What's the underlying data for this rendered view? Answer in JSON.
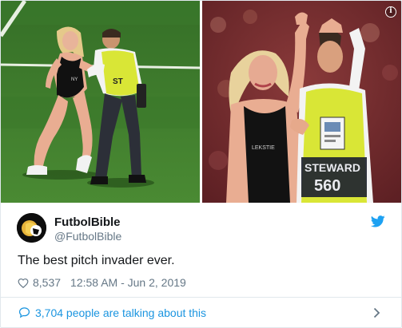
{
  "tweet": {
    "author": {
      "display_name": "FutbolBible",
      "handle": "@FutbolBible"
    },
    "text": "The best pitch invader ever.",
    "likes": "8,537",
    "timestamp": "12:58 AM - Jun 2, 2019",
    "talking": "3,704 people are talking about this"
  },
  "media": {
    "left_photo": {
      "vest_text": "ST",
      "shirt_text": "NY"
    },
    "right_photo": {
      "vest_text": "STEWARD",
      "vest_number": "560",
      "shirt_text": "LEKSTIE"
    }
  },
  "colors": {
    "link_blue": "#1b95e0",
    "twitter_blue": "#1da1f2",
    "muted": "#657786",
    "text": "#14171a",
    "pitch_green": "#3d7a2c",
    "vest_yellow": "#d9e636"
  },
  "icons": {
    "info": "info-icon",
    "bird": "twitter-bird-icon",
    "heart": "heart-icon",
    "speech": "speech-bubble-icon",
    "chevron": "chevron-right-icon"
  }
}
